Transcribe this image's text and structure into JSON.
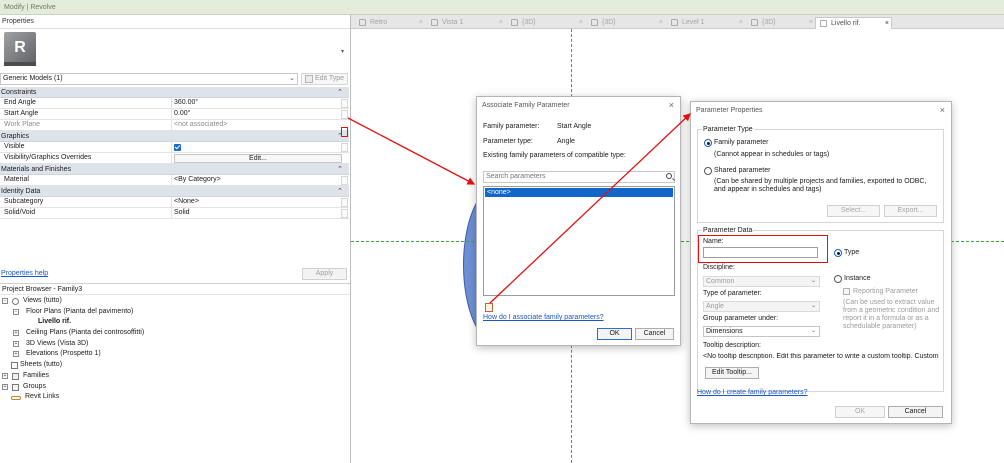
{
  "topbar": {
    "title": "Modify | Revolve"
  },
  "properties": {
    "title": "Properties",
    "type_selector": "Generic Models (1)",
    "edit_type": "Edit Type",
    "groups": {
      "constraints": "Constraints",
      "graphics": "Graphics",
      "materials": "Materials and Finishes",
      "identity": "Identity Data"
    },
    "rows": {
      "end_angle": {
        "label": "End Angle",
        "value": "360.00°"
      },
      "start_angle": {
        "label": "Start Angle",
        "value": "0.00°"
      },
      "work_plane": {
        "label": "Work Plane",
        "value": "<not associated>"
      },
      "visible": {
        "label": "Visible"
      },
      "vis_overrides": {
        "label": "Visibility/Graphics Overrides",
        "value": "Edit..."
      },
      "material": {
        "label": "Material",
        "value": "<By Category>"
      },
      "subcategory": {
        "label": "Subcategory",
        "value": "<None>"
      },
      "solid_void": {
        "label": "Solid/Void",
        "value": "Solid"
      }
    },
    "help_link": "Properties help",
    "apply": "Apply"
  },
  "browser": {
    "title": "Project Browser - Family3",
    "items": [
      "Views (tutto)",
      "Floor Plans (Pianta del pavimento)",
      "Livello rif.",
      "Ceiling Plans (Pianta dei controsoffitti)",
      "3D Views (Vista 3D)",
      "Elevations (Prospetto 1)",
      "Sheets (tutto)",
      "Families",
      "Groups",
      "Revit Links"
    ]
  },
  "tabs": [
    "Retro",
    "Vista 1",
    "{3D}",
    "{3D}",
    "Level 1",
    "{3D}",
    "Livello rif."
  ],
  "assoc_dialog": {
    "title": "Associate Family Parameter",
    "family_parameter_label": "Family parameter:",
    "family_parameter_value": "Start Angle",
    "parameter_type_label": "Parameter type:",
    "parameter_type_value": "Angle",
    "existing_label": "Existing family parameters of compatible type:",
    "search_placeholder": "Search parameters",
    "list_item": "<none>",
    "help_link": "How do I associate family parameters?",
    "ok": "OK",
    "cancel": "Cancel"
  },
  "param_dialog": {
    "title": "Parameter Properties",
    "parameter_type_legend": "Parameter Type",
    "family_parameter": "Family parameter",
    "family_parameter_note": "(Cannot appear in schedules or tags)",
    "shared_parameter": "Shared parameter",
    "shared_parameter_note": "(Can be shared by multiple projects and families, exported to ODBC, and appear in schedules and tags)",
    "select_btn": "Select...",
    "export_btn": "Export...",
    "parameter_data_legend": "Parameter Data",
    "name_label": "Name:",
    "name_value": "",
    "type_radio": "Type",
    "instance_radio": "Instance",
    "discipline_label": "Discipline:",
    "discipline_value": "Common",
    "type_of_parameter_label": "Type of parameter:",
    "type_of_parameter_value": "Angle",
    "reporting_parameter": "Reporting Parameter",
    "reporting_note": "(Can be used to extract value from a geometric condition and report it in a formula or as a schedulable parameter)",
    "group_under_label": "Group parameter under:",
    "group_under_value": "Dimensions",
    "tooltip_label": "Tooltip description:",
    "tooltip_value": "<No tooltip description. Edit this parameter to write a custom tooltip. Custom",
    "edit_tooltip_btn": "Edit Tooltip...",
    "help_link": "How do I create family parameters?",
    "ok": "OK",
    "cancel": "Cancel"
  },
  "colors": {
    "accent": "#1266c9",
    "annotation_red": "#e01010",
    "reference_green": "#38a836"
  }
}
